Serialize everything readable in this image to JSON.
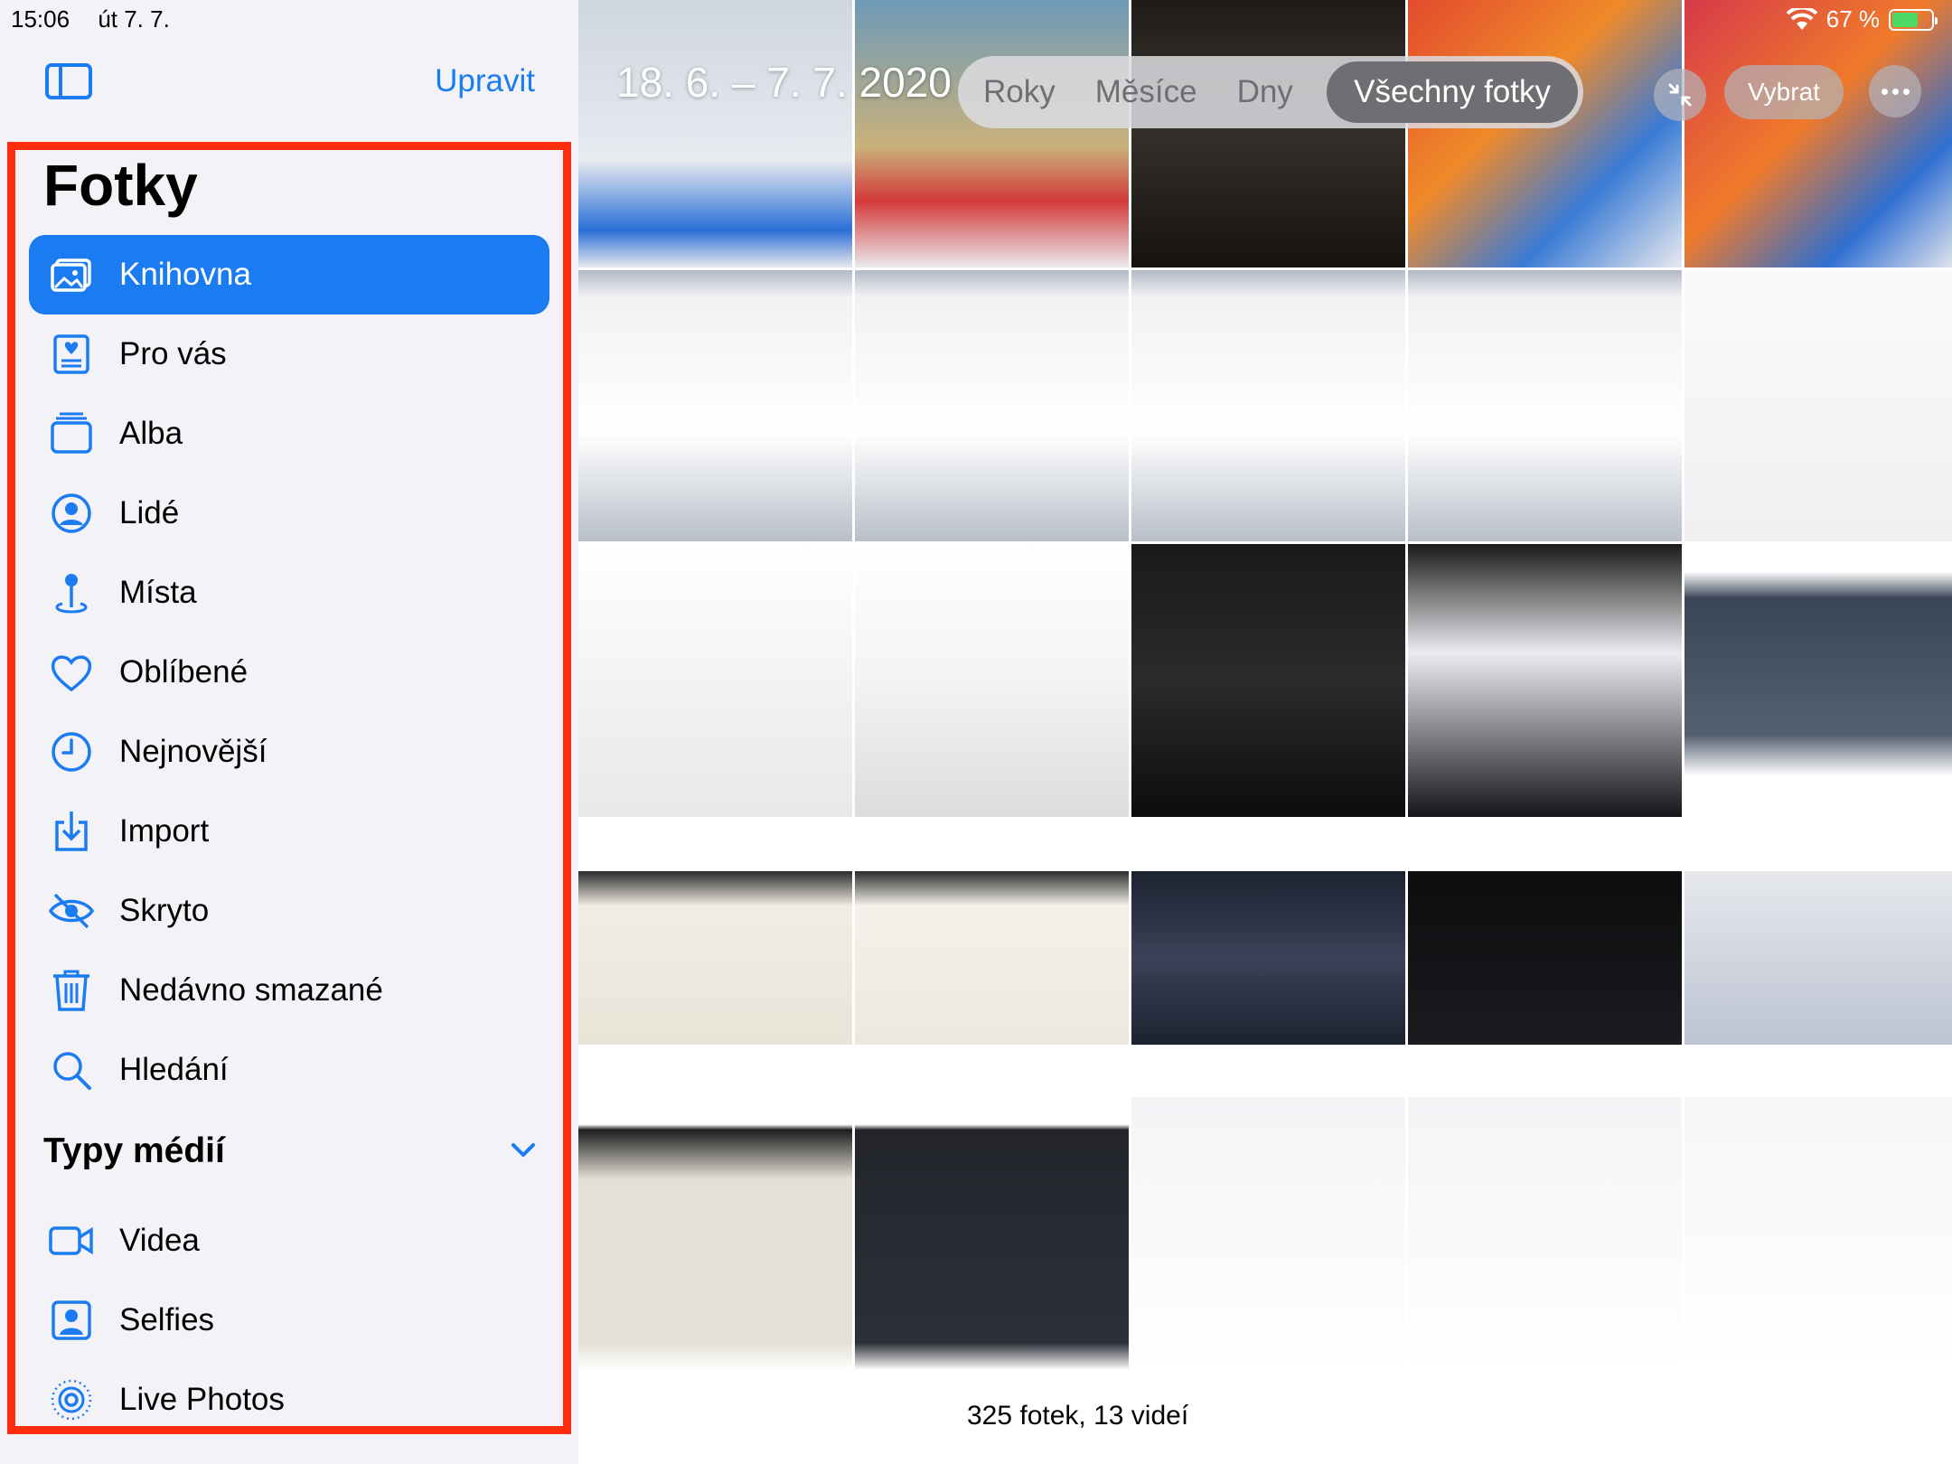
{
  "status": {
    "time": "15:06",
    "date": "út 7. 7.",
    "battery": "67 %",
    "battery_level": 0.67
  },
  "sidebar": {
    "edit_label": "Upravit",
    "title": "Fotky",
    "items": [
      {
        "label": "Knihovna",
        "icon": "library-icon",
        "active": true
      },
      {
        "label": "Pro vás",
        "icon": "for-you-icon"
      },
      {
        "label": "Alba",
        "icon": "albums-icon"
      },
      {
        "label": "Lidé",
        "icon": "people-icon"
      },
      {
        "label": "Místa",
        "icon": "places-icon"
      },
      {
        "label": "Oblíbené",
        "icon": "heart-icon"
      },
      {
        "label": "Nejnovější",
        "icon": "clock-icon"
      },
      {
        "label": "Import",
        "icon": "import-icon"
      },
      {
        "label": "Skryto",
        "icon": "hidden-eye-icon"
      },
      {
        "label": "Nedávno smazané",
        "icon": "trash-icon"
      },
      {
        "label": "Hledání",
        "icon": "search-icon"
      }
    ],
    "media_section_title": "Typy médií",
    "media_items": [
      {
        "label": "Videa",
        "icon": "video-icon"
      },
      {
        "label": "Selfies",
        "icon": "selfie-icon"
      },
      {
        "label": "Live Photos",
        "icon": "live-photo-icon"
      }
    ]
  },
  "content": {
    "date_range": "18. 6. – 7. 7. 2020",
    "segments": [
      "Roky",
      "Měsíce",
      "Dny",
      "Všechny fotky"
    ],
    "active_segment": "Všechny fotky",
    "select_label": "Vybrat",
    "photo_count": "325 fotek, 13 videí"
  },
  "colors": {
    "accent": "#1b7cf2",
    "highlight": "#ff2d0d",
    "sidebar_bg": "#f2f2f7"
  }
}
